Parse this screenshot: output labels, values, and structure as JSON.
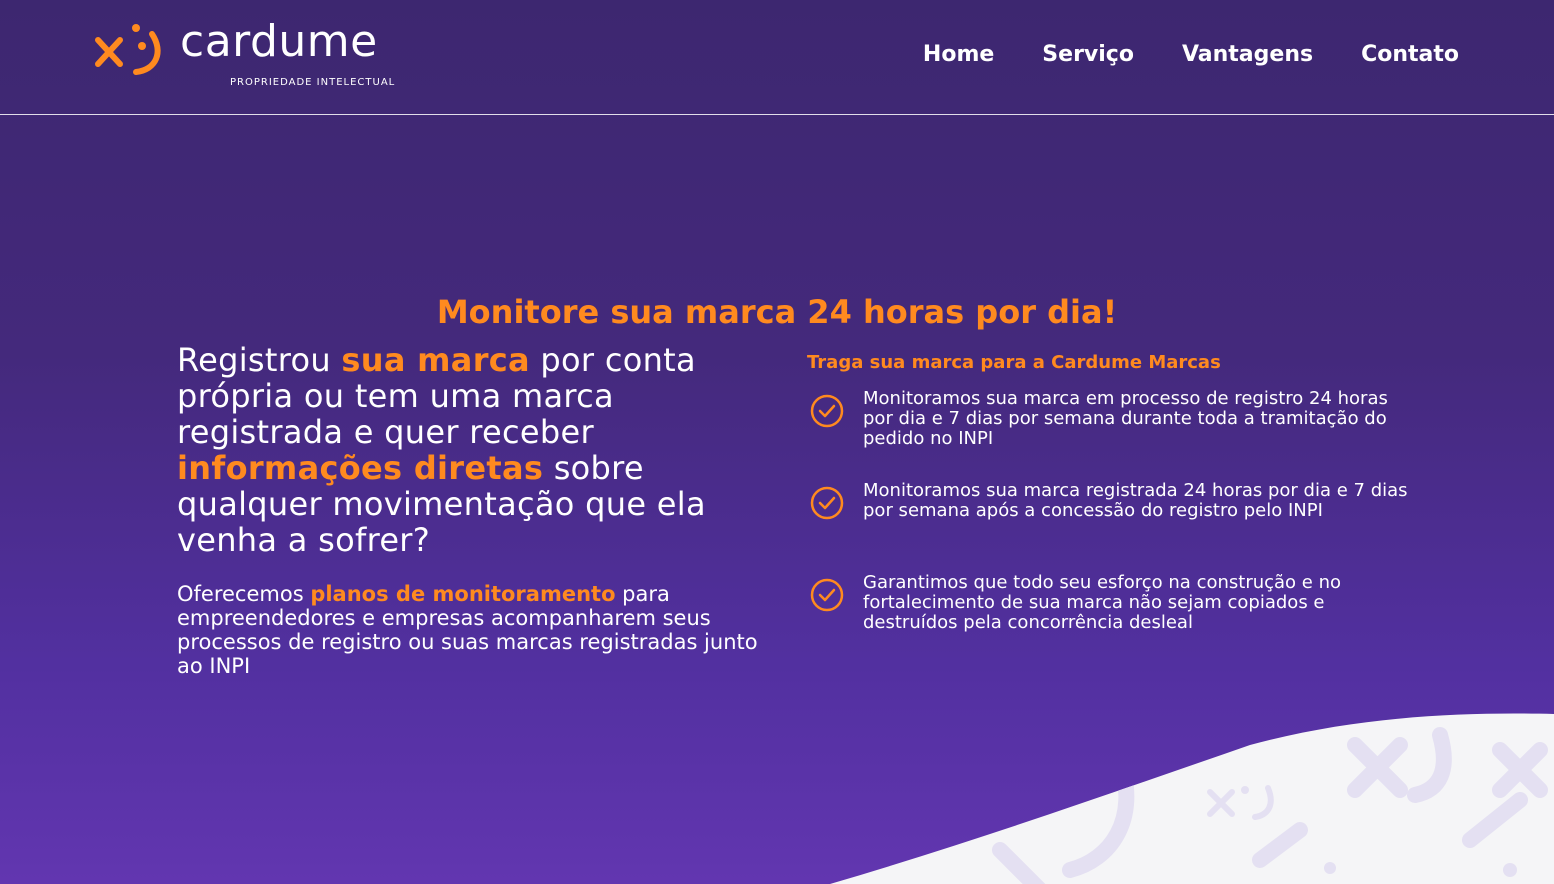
{
  "brand": {
    "name": "cardume",
    "tagline": "PROPRIEDADE INTELECTUAL",
    "accent_color": "#ff8a1f",
    "background_color": "#44297c"
  },
  "nav": {
    "items": [
      {
        "label": "Home"
      },
      {
        "label": "Serviço"
      },
      {
        "label": "Vantagens"
      },
      {
        "label": "Contato"
      }
    ]
  },
  "hero": {
    "headline": "Monitore sua marca 24 horas por dia!",
    "lead": {
      "part1": "Registrou ",
      "highlight1": "sua marca",
      "part2": " por conta própria ou tem uma marca registrada e quer receber ",
      "highlight2": "informações diretas",
      "part3": " sobre qualquer movimentação que ela venha a sofrer?"
    },
    "paragraph": {
      "part1": "Oferecemos ",
      "highlight": "planos de monitoramento",
      "part2": " para empreendedores e empresas acompanharem seus processos de registro ou suas marcas registradas junto ao INPI"
    }
  },
  "features": {
    "title": "Traga sua marca para a Cardume Marcas",
    "items": [
      {
        "text": "Monitoramos sua marca em processo de registro 24 horas por dia e 7 dias por semana durante toda a tramitação do pedido no INPI",
        "icon": "check-circle-icon"
      },
      {
        "text": "Monitoramos sua marca registrada 24 horas por dia e 7 dias por semana após a concessão do registro pelo INPI",
        "icon": "check-circle-icon"
      },
      {
        "text": "Garantimos que todo seu esforço na construção e no fortalecimento de sua marca não sejam copiados e destruídos pela concorrência desleal",
        "icon": "check-circle-icon"
      }
    ]
  }
}
